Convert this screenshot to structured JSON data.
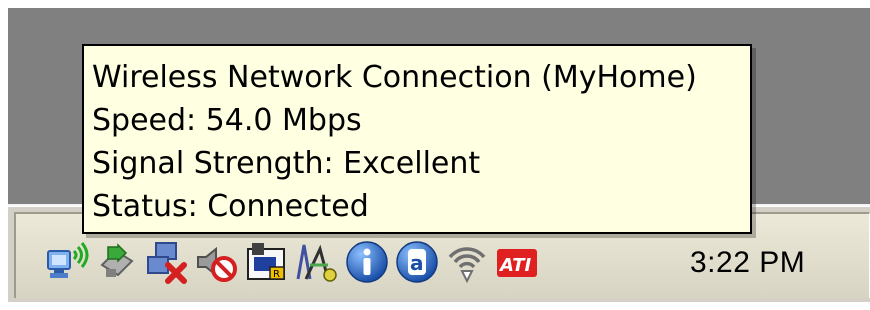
{
  "tooltip": {
    "network_name": "Wireless Network Connection (MyHome)",
    "speed": "Speed: 54.0 Mbps",
    "signal_strength": "Signal Strength: Excellent",
    "status": "Status: Connected"
  },
  "tray_icons": [
    {
      "name": "wireless-network-icon",
      "color": "#3a7ad8"
    },
    {
      "name": "safely-remove-hardware-icon",
      "color": "#3a9a3a"
    },
    {
      "name": "network-disconnected-icon",
      "color": "#d42020"
    },
    {
      "name": "blocked-speaker-icon",
      "color": "#808080"
    },
    {
      "name": "card-reader-icon",
      "color": "#f0c000"
    },
    {
      "name": "wireless-utility-icon",
      "color": "#4050a0"
    },
    {
      "name": "info-icon",
      "color": "#1f5fb8"
    },
    {
      "name": "a-icon",
      "color": "#1f5fb8"
    },
    {
      "name": "wifi-signal-icon",
      "color": "#707070"
    },
    {
      "name": "ati-icon",
      "color": "#e02020"
    }
  ],
  "clock": {
    "time": "3:22 PM"
  }
}
